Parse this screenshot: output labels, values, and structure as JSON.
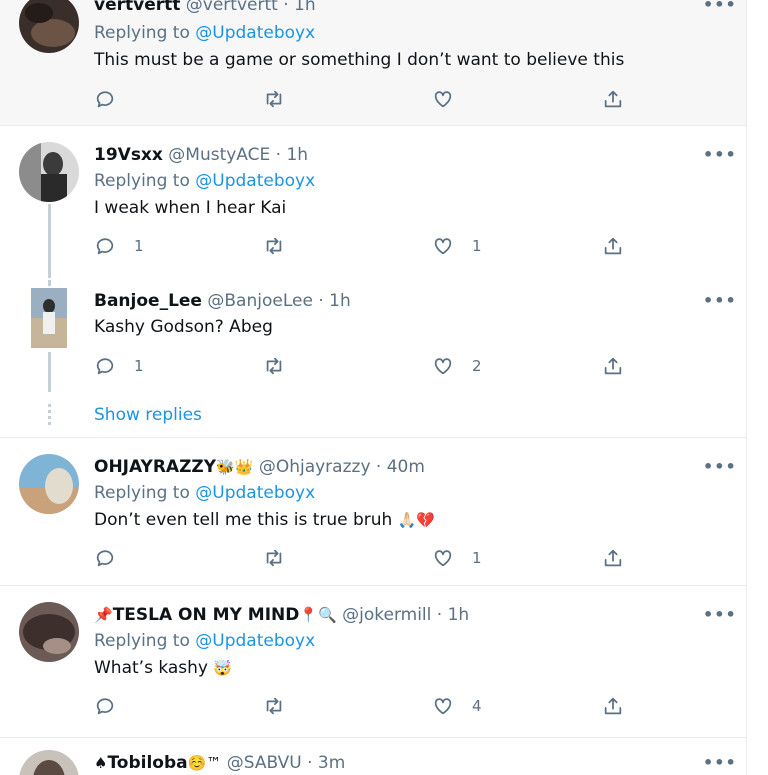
{
  "tweets": [
    {
      "name": "vertvertt",
      "handle": "@vertvertt",
      "time": "1h",
      "replying_prefix": "Replying to ",
      "replying_handle": "@Updateboyx",
      "text": "This must be a game or something I don’t want to believe this",
      "replies": "",
      "retweets": "",
      "likes": ""
    },
    {
      "name": "19Vsxx",
      "handle": "@MustyACE",
      "time": "1h",
      "replying_prefix": "Replying to ",
      "replying_handle": "@Updateboyx",
      "text": "I weak when I hear Kai",
      "replies": "1",
      "retweets": "",
      "likes": "1"
    },
    {
      "name": "Banjoe_Lee",
      "handle": "@BanjoeLee",
      "time": "1h",
      "text": "Kashy Godson? Abeg",
      "replies": "1",
      "retweets": "",
      "likes": "2"
    },
    {
      "name": "OHJAYRAZZY",
      "name_emoji": "🐝👑",
      "handle": "@Ohjayrazzy",
      "time": "40m",
      "replying_prefix": "Replying to ",
      "replying_handle": "@Updateboyx",
      "text": "Don’t even tell me this is true bruh",
      "text_emoji": "🙏🏻💔",
      "replies": "",
      "retweets": "",
      "likes": "1"
    },
    {
      "name_emoji_pre": "📌",
      "name": "TESLA ON MY MIND",
      "name_emoji": "📍🔍",
      "handle": "@jokermill",
      "time": "1h",
      "replying_prefix": "Replying to ",
      "replying_handle": "@Updateboyx",
      "text": "What’s kashy",
      "text_emoji": "🤯",
      "replies": "",
      "retweets": "",
      "likes": "4"
    },
    {
      "name_emoji_pre": "♠",
      "name": "Tobiloba",
      "name_emoji": "☺️™",
      "handle": "@SABVU",
      "time": "3m"
    }
  ],
  "show_replies": "Show replies",
  "dot_sep": "·",
  "more_glyph": "•••",
  "icons": [
    "reply-icon",
    "retweet-icon",
    "like-icon",
    "share-icon",
    "more-icon"
  ],
  "colors": {
    "link": "#1b95e0",
    "muted": "#5b7083",
    "text": "#0f1419",
    "highlight_bg": "#f5f8fa",
    "border": "#e6ecf0"
  }
}
